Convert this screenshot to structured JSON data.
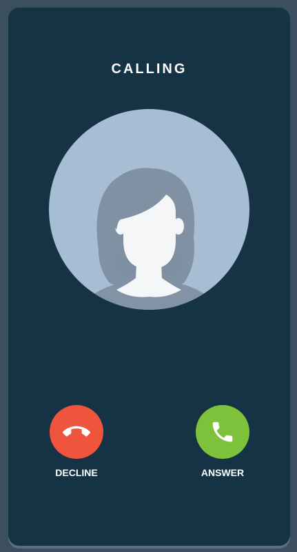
{
  "screen": {
    "status_text": "CALLING"
  },
  "caller": {
    "avatar_icon": "female-avatar-icon"
  },
  "actions": {
    "decline": {
      "label": "DECLINE",
      "icon": "phone-hangup-icon",
      "color": "#ee553c"
    },
    "answer": {
      "label": "ANSWER",
      "icon": "phone-icon",
      "color": "#7ec13b"
    }
  },
  "colors": {
    "background": "#3b4f5f",
    "panel": "#163345",
    "avatar_bg": "#a7bdd3"
  }
}
